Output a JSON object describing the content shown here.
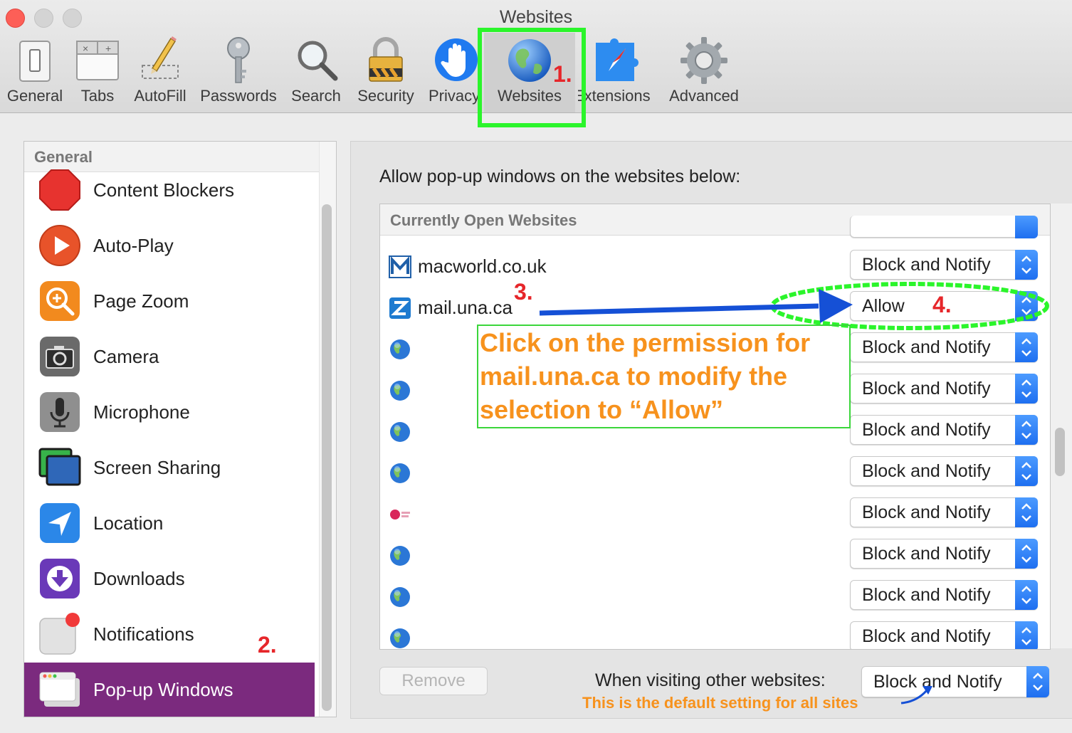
{
  "window": {
    "title": "Websites"
  },
  "toolbar": {
    "tabs": [
      {
        "label": "General",
        "icon": "general-switch-icon"
      },
      {
        "label": "Tabs",
        "icon": "tabs-icon"
      },
      {
        "label": "AutoFill",
        "icon": "pencil-form-icon"
      },
      {
        "label": "Passwords",
        "icon": "key-icon"
      },
      {
        "label": "Search",
        "icon": "magnifier-icon"
      },
      {
        "label": "Security",
        "icon": "padlock-icon"
      },
      {
        "label": "Privacy",
        "icon": "hand-icon"
      },
      {
        "label": "Websites",
        "icon": "globe-icon",
        "selected": true
      },
      {
        "label": "Extensions",
        "icon": "compass-puzzle-icon"
      },
      {
        "label": "Advanced",
        "icon": "gear-icon"
      }
    ]
  },
  "sidebar": {
    "header": "General",
    "items": [
      {
        "label": "Content Blockers",
        "icon": "stop-sign-icon"
      },
      {
        "label": "Auto-Play",
        "icon": "play-icon"
      },
      {
        "label": "Page Zoom",
        "icon": "zoom-icon"
      },
      {
        "label": "Camera",
        "icon": "camera-icon"
      },
      {
        "label": "Microphone",
        "icon": "microphone-icon"
      },
      {
        "label": "Screen Sharing",
        "icon": "screen-sharing-icon"
      },
      {
        "label": "Location",
        "icon": "location-arrow-icon"
      },
      {
        "label": "Downloads",
        "icon": "download-icon"
      },
      {
        "label": "Notifications",
        "icon": "notifications-icon"
      },
      {
        "label": "Pop-up Windows",
        "icon": "popup-window-icon",
        "selected": true
      }
    ]
  },
  "main": {
    "instruction": "Allow pop-up windows on the websites below:",
    "table_header": "Currently Open Websites",
    "rows": [
      {
        "site": "macworld.co.uk",
        "favicon": "macworld-favicon",
        "setting": "Block and Notify"
      },
      {
        "site": "mail.una.ca",
        "favicon": "una-favicon",
        "setting": "Allow"
      },
      {
        "site": "",
        "favicon": "globe-favicon",
        "setting": "Block and Notify"
      },
      {
        "site": "",
        "favicon": "globe-favicon",
        "setting": "Block and Notify"
      },
      {
        "site": "",
        "favicon": "globe-favicon",
        "setting": "Block and Notify"
      },
      {
        "site": "",
        "favicon": "globe-favicon",
        "setting": "Block and Notify"
      },
      {
        "site": "",
        "favicon": "pink-logo-favicon",
        "setting": "Block and Notify"
      },
      {
        "site": "",
        "favicon": "globe-favicon",
        "setting": "Block and Notify"
      },
      {
        "site": "",
        "favicon": "globe-favicon",
        "setting": "Block and Notify"
      },
      {
        "site": "",
        "favicon": "globe-favicon",
        "setting": "Block and Notify"
      }
    ],
    "remove_label": "Remove",
    "visiting_label": "When visiting other websites:",
    "default_setting": "Block and Notify"
  },
  "annotations": {
    "step1": "1.",
    "step2": "2.",
    "step3": "3.",
    "step4": "4.",
    "callout": "Click on the permission for mail.una.ca to modify the selection to “Allow”",
    "default_note": "This is the default setting for all sites"
  },
  "colors": {
    "selection_purple": "#7b2a7e",
    "annotation_green": "#2bf52b",
    "annotation_red": "#e6262a",
    "annotation_orange": "#f7921d",
    "arrow_blue": "#1550d6",
    "popup_blue": "#2c7df5"
  }
}
